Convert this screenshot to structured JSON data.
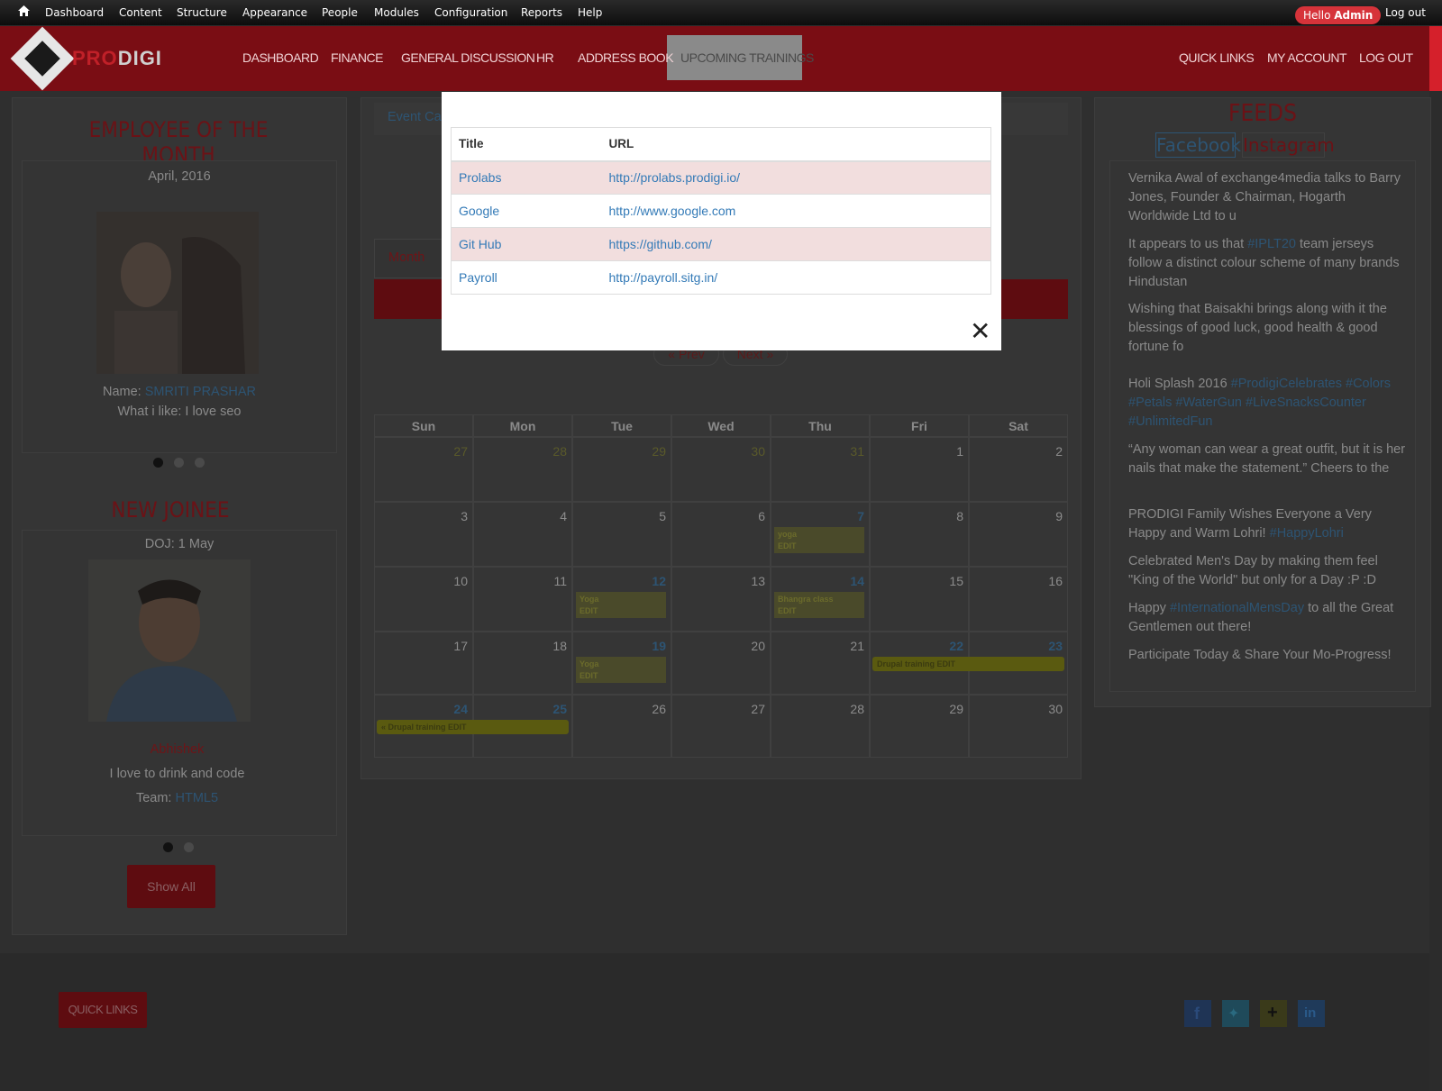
{
  "admin_bar": {
    "items": [
      "Dashboard",
      "Content",
      "Structure",
      "Appearance",
      "People",
      "Modules",
      "Configuration",
      "Reports",
      "Help"
    ],
    "hello_prefix": "Hello",
    "hello_user": "Admin",
    "logout": "Log out"
  },
  "header": {
    "logo_pro": "PRO",
    "logo_digi": "DIGI",
    "nav": [
      "DASHBOARD",
      "FINANCE",
      "GENERAL DISCUSSION",
      "HR",
      "ADDRESS BOOK",
      "UPCOMING TRAININGS"
    ],
    "right_nav": [
      "QUICK LINKS",
      "MY ACCOUNT",
      "LOG OUT"
    ]
  },
  "employee": {
    "title": "EMPLOYEE OF THE MONTH",
    "month": "April, 2016",
    "name_label": "Name:",
    "name": "SMRITI PRASHAR",
    "likes": "What i like: I love seo"
  },
  "joinee": {
    "title": "NEW JOINEE",
    "doj": "DOJ: 1 May",
    "name": "Abhishek",
    "likes": "I love to drink and code",
    "team_label": "Team:",
    "team": "HTML5",
    "show_all": "Show All"
  },
  "calendar": {
    "event_tab": "Event Ca",
    "month_tab": "Month",
    "prev": "« Prev",
    "next": "Next »",
    "days": [
      "Sun",
      "Mon",
      "Tue",
      "Wed",
      "Thu",
      "Fri",
      "Sat"
    ],
    "week1": [
      "27",
      "28",
      "29",
      "30",
      "31",
      "1",
      "2"
    ],
    "week2": [
      "3",
      "4",
      "5",
      "6",
      "7",
      "8",
      "9"
    ],
    "week3": [
      "10",
      "11",
      "12",
      "13",
      "14",
      "15",
      "16"
    ],
    "week4": [
      "17",
      "18",
      "19",
      "20",
      "21",
      "22",
      "23"
    ],
    "week5": [
      "24",
      "25",
      "26",
      "27",
      "28",
      "29",
      "30"
    ],
    "events": {
      "yoga7": "yoga",
      "edit": "EDIT",
      "yoga12": "Yoga",
      "bhangra": "Bhangra class",
      "yoga19": "Yoga",
      "drupal1": "Drupal training EDIT",
      "drupal2": "« Drupal training EDIT"
    }
  },
  "feeds": {
    "title": "FEEDS",
    "tab_facebook": "Facebook",
    "tab_instagram": "Instagram",
    "item1": "Vernika Awal of exchange4media talks to Barry Jones, Founder & Chairman, Hogarth Worldwide Ltd to u",
    "item2_a": "It appears to us that ",
    "item2_tag": "#IPLT20",
    "item2_b": " team jerseys follow a distinct colour scheme of many brands Hindustan",
    "item3": "Wishing that Baisakhi brings along with it the blessings of good luck, good health & good fortune fo",
    "item4_a": "Holi Splash 2016 ",
    "item4_tags": "#ProdigiCelebrates #Colors #Petals #WaterGun #LiveSnacksCounter #UnlimitedFun",
    "item5": "“Any woman can wear a great outfit, but it is her nails that make the statement.” Cheers to the",
    "item6_a": "PRODIGI Family Wishes Everyone a Very Happy and Warm Lohri! ",
    "item6_tag": "#HappyLohri",
    "item7": "Celebrated Men's Day by making them feel \"King of the World\" but only for a Day :P :D",
    "item8_a": "Happy ",
    "item8_tag": "#InternationalMensDay",
    "item8_b": " to all the Great Gentlemen out there!",
    "item9": "Participate Today & Share Your Mo-Progress!"
  },
  "footer": {
    "quick_links": "QUICK LINKS"
  },
  "modal": {
    "col_title": "Title",
    "col_url": "URL",
    "rows": [
      {
        "title": "Prolabs",
        "url": "http://prolabs.prodigi.io/"
      },
      {
        "title": "Google",
        "url": "http://www.google.com"
      },
      {
        "title": "Git Hub",
        "url": "https://github.com/"
      },
      {
        "title": "Payroll",
        "url": "http://payroll.sitg.in/"
      }
    ],
    "close": "✕"
  },
  "colors": {
    "brand_red": "#7a0d14",
    "link_blue": "#337ab7",
    "row_pink": "#f2dede"
  }
}
